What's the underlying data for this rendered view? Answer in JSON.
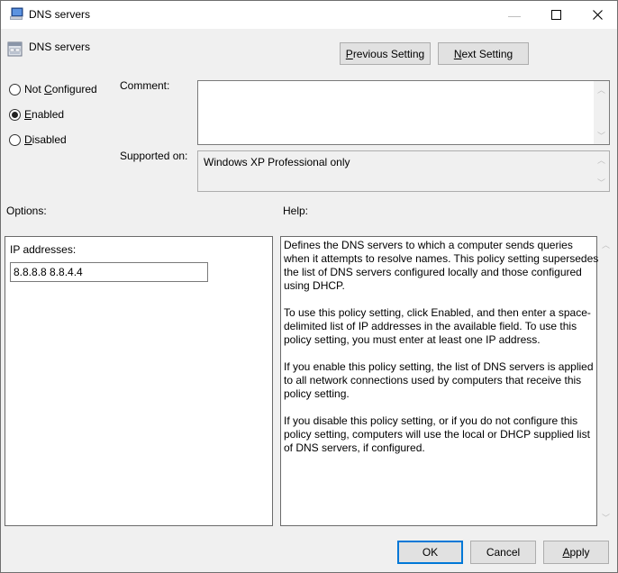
{
  "window": {
    "title": "DNS servers",
    "controls": {
      "minimize": "—",
      "maximize": "☐",
      "close": "✕"
    }
  },
  "header": {
    "title": "DNS servers",
    "previous_button": {
      "prefix": "",
      "accel": "P",
      "rest": "revious Setting"
    },
    "next_button": {
      "prefix": "",
      "accel": "N",
      "rest": "ext Setting"
    }
  },
  "state": {
    "options": [
      {
        "pre": "Not ",
        "accel": "C",
        "post": "onfigured",
        "selected": false
      },
      {
        "pre": "",
        "accel": "E",
        "post": "nabled",
        "selected": true
      },
      {
        "pre": "",
        "accel": "D",
        "post": "isabled",
        "selected": false
      }
    ]
  },
  "comment": {
    "label": "Comment:",
    "value": ""
  },
  "supported": {
    "label": "Supported on:",
    "value": "Windows XP Professional only"
  },
  "options_section": {
    "label": "Options:",
    "ip_label": "IP addresses:",
    "ip_value": "8.8.8.8 8.8.4.4"
  },
  "help_section": {
    "label": "Help:",
    "paragraphs": [
      "Defines the DNS servers to which a computer sends queries when it attempts to resolve names. This policy setting supersedes the list of DNS servers configured locally and those configured using DHCP.",
      "To use this policy setting, click Enabled, and then enter a space-delimited list of IP addresses in the available field. To use this policy setting, you must enter at least one IP address.",
      "If you enable this policy setting, the list of DNS servers is applied to all network connections used by computers that receive this policy setting.",
      "If you disable this policy setting, or if you do not configure this policy setting, computers will use the local or DHCP supplied list of DNS servers, if configured."
    ]
  },
  "footer": {
    "ok": "OK",
    "cancel": "Cancel",
    "apply": {
      "accel": "A",
      "rest": "pply"
    }
  },
  "colors": {
    "accent": "#0078d7",
    "window_bg": "#f0f0f0",
    "button_bg": "#e1e1e1"
  }
}
